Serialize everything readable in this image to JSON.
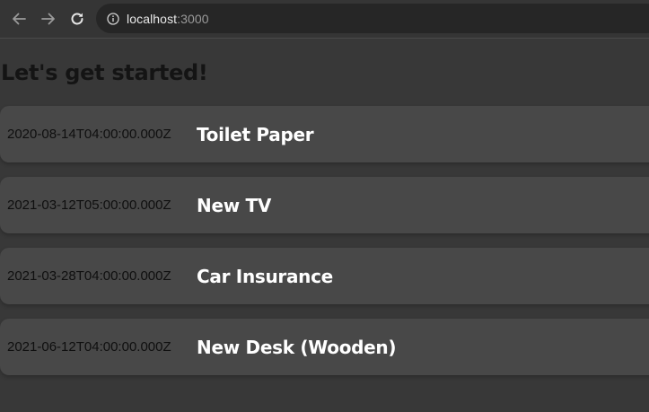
{
  "browser": {
    "url_host": "localhost",
    "url_port": ":3000",
    "icons": {
      "back": "arrow-left-icon",
      "forward": "arrow-right-icon",
      "reload": "reload-icon",
      "info": "info-icon"
    }
  },
  "page": {
    "title": "Let's get started!",
    "items": [
      {
        "date": "2020-08-14T04:00:00.000Z",
        "name": "Toilet Paper"
      },
      {
        "date": "2021-03-12T05:00:00.000Z",
        "name": "New TV"
      },
      {
        "date": "2021-03-28T04:00:00.000Z",
        "name": "Car Insurance"
      },
      {
        "date": "2021-06-12T04:00:00.000Z",
        "name": "New Desk (Wooden)"
      }
    ]
  },
  "colors": {
    "page_background": "#383838",
    "card_background": "#484848",
    "title_text": "#141414",
    "date_text": "#0f0f0f",
    "name_text": "#ffffff"
  }
}
